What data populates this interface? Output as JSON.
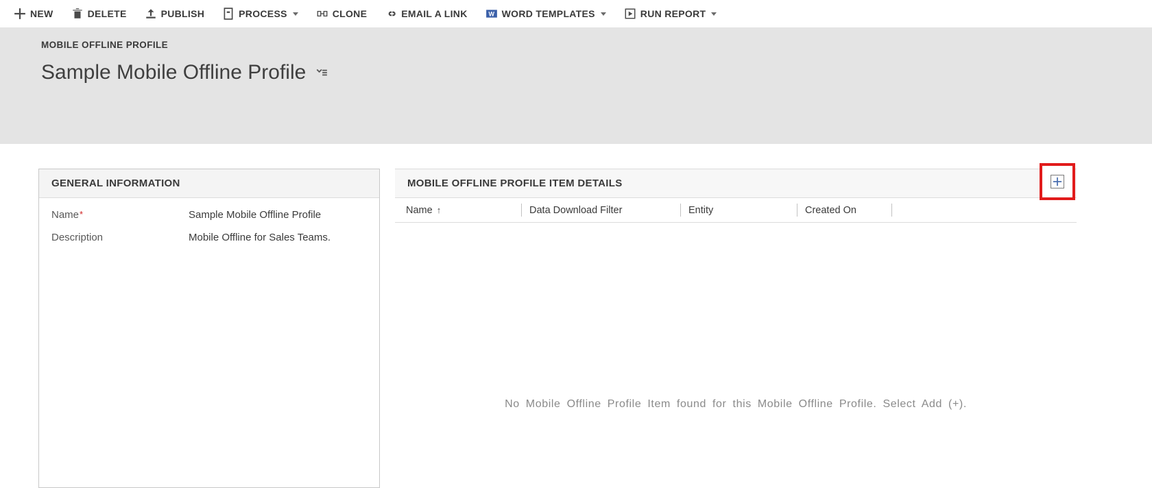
{
  "toolbar": {
    "new": "NEW",
    "delete": "DELETE",
    "publish": "PUBLISH",
    "process": "PROCESS",
    "clone": "CLONE",
    "email_link": "EMAIL A LINK",
    "word_templates": "WORD TEMPLATES",
    "run_report": "RUN REPORT"
  },
  "header": {
    "entity_label": "MOBILE OFFLINE PROFILE",
    "record_title": "Sample Mobile Offline Profile"
  },
  "general": {
    "section_title": "GENERAL INFORMATION",
    "name_label": "Name",
    "name_value": "Sample Mobile Offline Profile",
    "description_label": "Description",
    "description_value": "Mobile Offline for Sales Teams."
  },
  "details": {
    "section_title": "MOBILE OFFLINE PROFILE ITEM DETAILS",
    "columns": {
      "name": "Name",
      "filter": "Data Download Filter",
      "entity": "Entity",
      "created_on": "Created On"
    },
    "sort_indicator": "↑",
    "empty_message": "No Mobile Offline Profile Item found for this Mobile Offline Profile. Select Add (+)."
  }
}
